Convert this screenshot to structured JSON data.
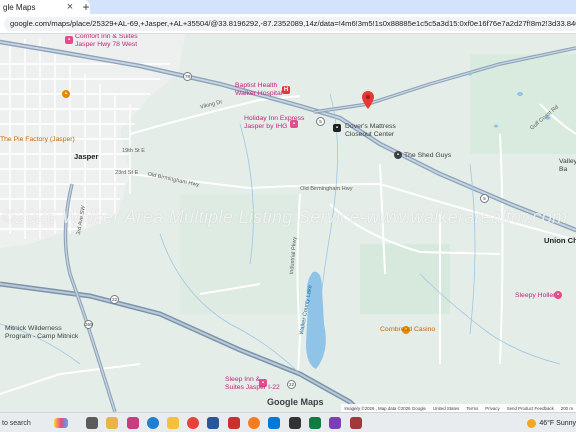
{
  "browser": {
    "tab_title": "gle Maps",
    "tab_close": "×",
    "new_tab": "+",
    "url": "google.com/maps/place/25329+AL-69,+Jasper,+AL+35504/@33.8196292,-87.2352089,14z/data=!4m6!3m5!1s0x88885e1c5c5a3d15:0xf0e16f76e7a2d27f!8m2!3d33.8400758!4d-87.2184983!16s%2Fg%2F11h930s..."
  },
  "map": {
    "pin_color": "#e53935",
    "watermark": "©2026 Walker Area Multiple Listing Service-www.walkerarealtor.com",
    "brand": "Google Maps",
    "labels": {
      "comfort_inn": "Comfort Inn & Suites\nJasper Hwy 78 West",
      "baptist": "Baptist Health\nWalker Hospital",
      "holiday_inn": "Holiday Inn Express\nJasper by IHG",
      "dovers": "Dover's Mattress\nCloseout Center",
      "shed_guys": "The Shed Guys",
      "pie_factory": "The Pie Factory (Jasper)",
      "jasper": "Jasper",
      "union_chapel": "Union Chap",
      "valley": "Valley\nBa",
      "sleepy_holler": "Sleepy Holler",
      "cornbread": "Cornbread Casino",
      "mitnick": "Mitnick Wilderness\nProgram - Camp Mitnick",
      "sleep_inn": "Sleep Inn &\nSuites Jasper I-22",
      "walker_county_lake": "Walker County Lake",
      "viking_dr": "Viking Dr",
      "old_birmingham": "Old Birmingham Hwy",
      "industrial_pkwy": "Industrial Pkwy",
      "st_19th": "19th St E",
      "st_23rd": "23rd St E",
      "3rd_ave": "3rd Ave SW",
      "gulf_coast": "Gulf Coast Rd",
      "old_birmingham2": "Old Birmingham Hwy",
      "route_78": "78",
      "route_5": "5",
      "route_22": "22",
      "route_269": "269",
      "route_118": "118"
    },
    "attribution": [
      "Imagery ©2026 , Map data ©2026 Google",
      "United States",
      "Terms",
      "Privacy",
      "Send Product Feedback",
      "200 m"
    ]
  },
  "taskbar": {
    "search": "to search",
    "weather": "46°F  Sunny"
  }
}
